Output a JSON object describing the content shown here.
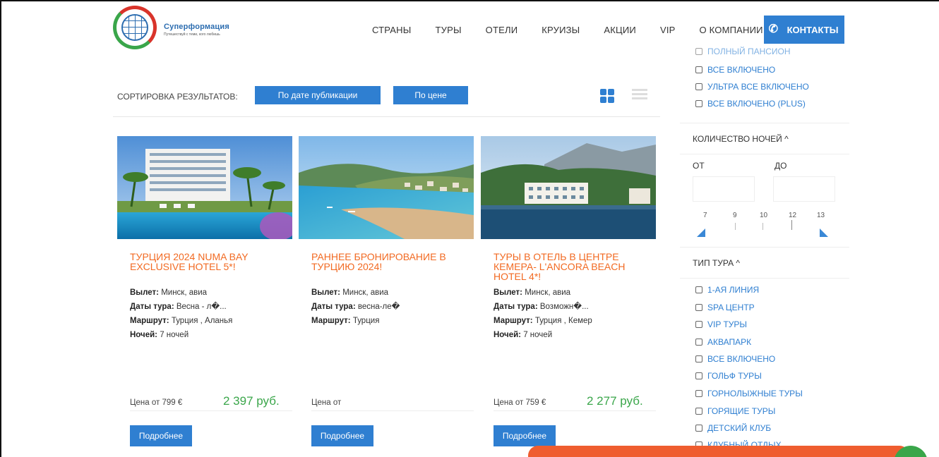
{
  "brand": {
    "title": "Суперформация",
    "subtitle": "Путешествуй с теми, кого любишь"
  },
  "nav": {
    "items": [
      "СТРАНЫ",
      "ТУРЫ",
      "ОТЕЛИ",
      "КРУИЗЫ",
      "АКЦИИ",
      "VIP",
      "О КОМПАНИИ"
    ],
    "contacts": "КОНТАКТЫ"
  },
  "sort": {
    "label": "СОРТИРОВКА РЕЗУЛЬТАТОВ:",
    "by_date": "По дате публикации",
    "by_price": "По цене"
  },
  "cards": [
    {
      "title": "ТУРЦИЯ 2024 NUMA BAY EXCLUSIVE HOTEL 5*!",
      "departure_label": "Вылет:",
      "departure": "Минск, авиа",
      "dates_label": "Даты тура:",
      "dates": "Весна - л�...",
      "route_label": "Маршрут:",
      "route": "Турция , Аланья",
      "nights_label": "Ночей:",
      "nights": "7 ночей",
      "price_from": "Цена от 799 €",
      "price": "2 397 руб.",
      "more": "Подробнее"
    },
    {
      "title": "РАННЕЕ БРОНИРОВАНИЕ В ТУРЦИЮ 2024!",
      "departure_label": "Вылет:",
      "departure": "Минск, авиа",
      "dates_label": "Даты тура:",
      "dates": "весна-ле�",
      "route_label": "Маршрут:",
      "route": "Турция",
      "price_from": "Цена от",
      "more": "Подробнее"
    },
    {
      "title": "ТУРЫ В ОТЕЛЬ В ЦЕНТРЕ КЕМЕРА- L'ANCORA BEACH HOTEL 4*!",
      "departure_label": "Вылет:",
      "departure": "Минск, авиа",
      "dates_label": "Даты тура:",
      "dates": "Возможн�...",
      "route_label": "Маршрут:",
      "route": "Турция , Кемер",
      "nights_label": "Ночей:",
      "nights": "7 ночей",
      "price_from": "Цена от 759 €",
      "price": "2 277 руб.",
      "more": "Подробнее"
    }
  ],
  "sidebar": {
    "meal_options": [
      "ПОЛНЫЙ ПАНСИОН",
      "ВСЕ ВКЛЮЧЕНО",
      "УЛЬТРА ВСЕ ВКЛЮЧЕНО",
      "ВСЕ ВКЛЮЧЕНО (PLUS)"
    ],
    "nights_title": "КОЛИЧЕСТВО НОЧЕЙ ^",
    "from_label": "ОТ",
    "to_label": "ДО",
    "slider_ticks": [
      "7",
      "9",
      "10",
      "12",
      "13"
    ],
    "tour_type_title": "ТИП ТУРА ^",
    "tour_types": [
      "1-АЯ ЛИНИЯ",
      "SPA ЦЕНТР",
      "VIP ТУРЫ",
      "АКВАПАРК",
      "ВСЕ ВКЛЮЧЕНО",
      "ГОЛЬФ ТУРЫ",
      "ГОРНОЛЫЖНЫЕ ТУРЫ",
      "ГОРЯЩИЕ ТУРЫ",
      "ДЕТСКИЙ КЛУБ",
      "КЛУБНЫЙ ОТДЫХ"
    ]
  },
  "colors": {
    "accent": "#2f7fd1",
    "title_orange": "#f26a22",
    "price_green": "#3aa64a",
    "banner_orange": "#ef5d2f"
  }
}
